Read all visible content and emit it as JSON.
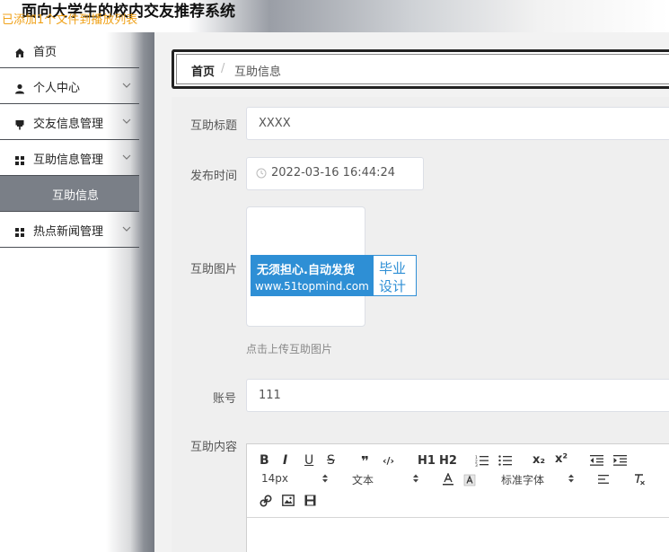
{
  "header": {
    "app_title": "面向大学生的校内交友推荐系统",
    "notice": "已添加1个文件到播放列表"
  },
  "sidebar": {
    "items": [
      {
        "label": "首页",
        "icon": "home-icon"
      },
      {
        "label": "个人中心",
        "icon": "user-icon"
      },
      {
        "label": "交友信息管理",
        "icon": "pin-icon"
      },
      {
        "label": "互助信息管理",
        "icon": "grid-icon"
      },
      {
        "label": "互助信息",
        "icon": ""
      },
      {
        "label": "热点新闻管理",
        "icon": "grid-icon"
      }
    ]
  },
  "breadcrumb": {
    "home": "首页",
    "separator": "/",
    "current": "互助信息"
  },
  "form": {
    "title_label": "互助标题",
    "title_value": "XXXX",
    "time_label": "发布时间",
    "time_value": "2022-03-16 16:44:24",
    "image_label": "互助图片",
    "upload_tip": "点击上传互助图片",
    "watermark": {
      "line1": "无须担心.自动发货",
      "line2": "www.51topmind.com",
      "right1": "毕业",
      "right2": "设计"
    },
    "account_label": "账号",
    "account_value": "111",
    "content_label": "互助内容"
  },
  "editor": {
    "toolbar": {
      "bold": "B",
      "italic": "I",
      "underline": "U",
      "strike": "S",
      "quote": "❞",
      "code": "‹/›",
      "h1": "H1",
      "h2": "H2",
      "subscript": "x₂",
      "superscript": "x²",
      "font_size": "14px",
      "text_type": "文本",
      "font_family": "标准字体"
    }
  },
  "colors": {
    "accent": "#2e8fd5",
    "notice": "#f0a21a",
    "active_menu": "#7a7f87"
  }
}
